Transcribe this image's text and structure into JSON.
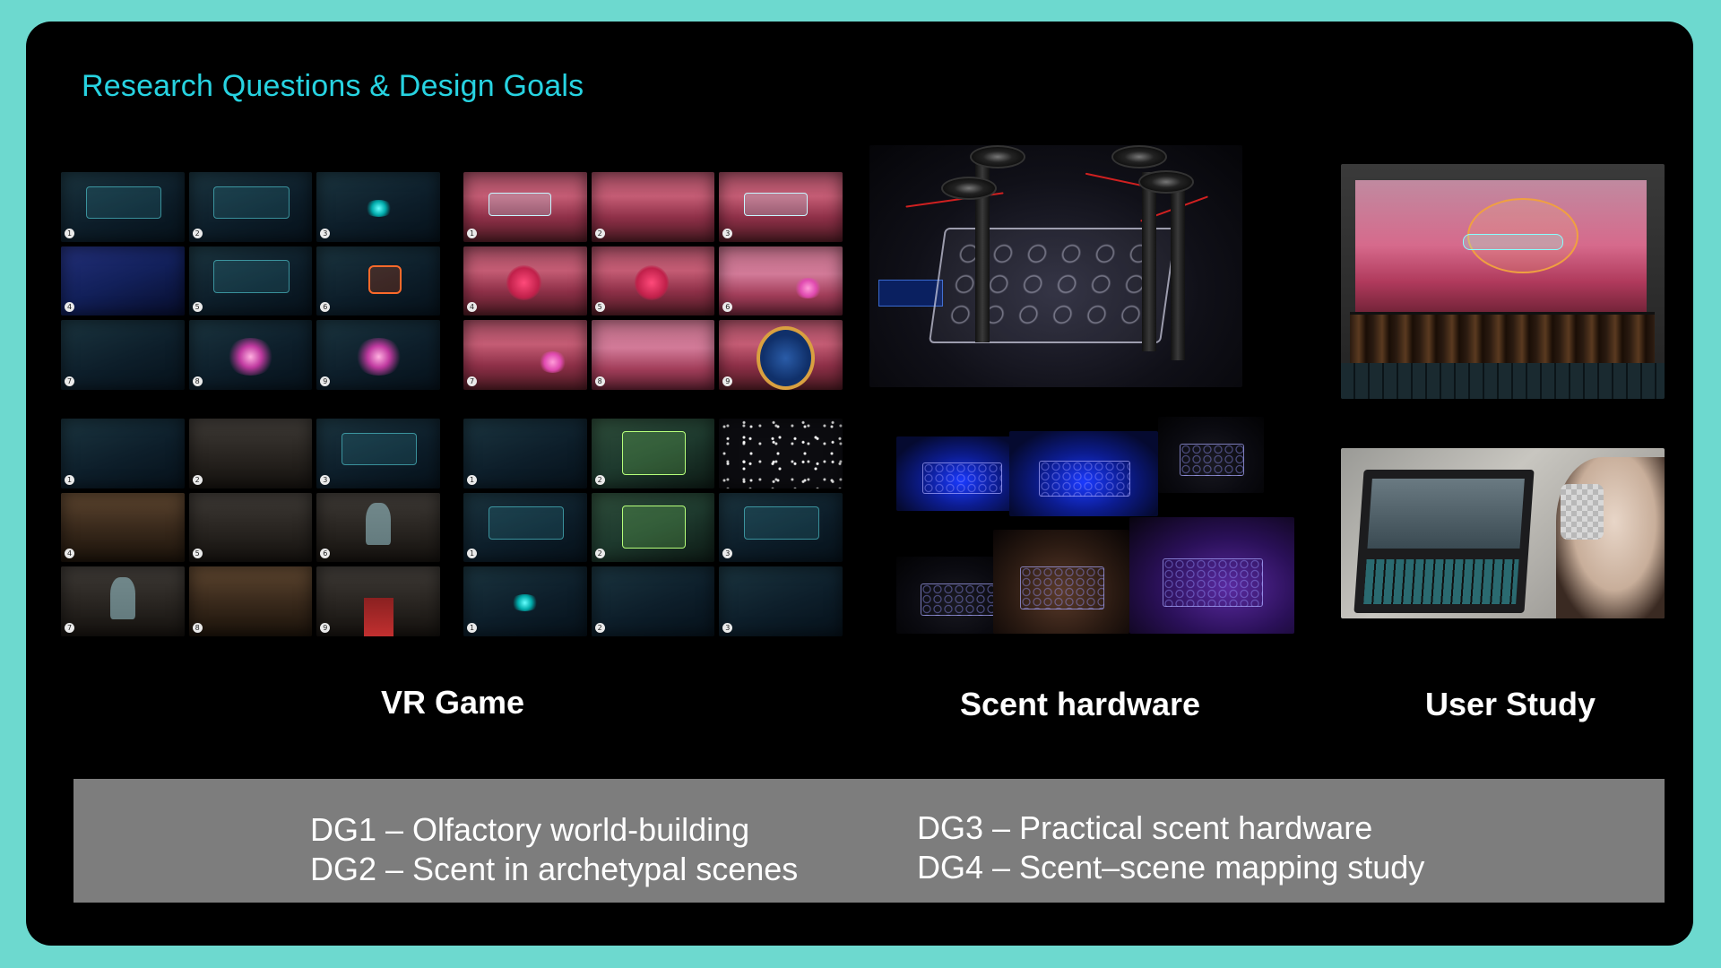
{
  "title": "Research Questions & Design Goals",
  "labels": {
    "vr_game": "VR Game",
    "scent_hardware": "Scent hardware",
    "user_study": "User Study"
  },
  "design_goals": [
    "DG1 – Olfactory world-building",
    "DG2 – Scent in archetypal scenes",
    "DG3 – Practical scent hardware",
    "DG4 – Scent–scene mapping study"
  ],
  "grids": [
    {
      "tiles": [
        {
          "n": "1",
          "cls": "sci glow"
        },
        {
          "n": "2",
          "cls": "sci glow"
        },
        {
          "n": "3",
          "cls": "sci cyan"
        },
        {
          "n": "4",
          "cls": "sci blue"
        },
        {
          "n": "5",
          "cls": "sci glow"
        },
        {
          "n": "6",
          "cls": "sci orange"
        },
        {
          "n": "7",
          "cls": "sci"
        },
        {
          "n": "8",
          "cls": "sci pink"
        },
        {
          "n": "9",
          "cls": "sci pink"
        }
      ]
    },
    {
      "tiles": [
        {
          "n": "1",
          "cls": "forest panel"
        },
        {
          "n": "2",
          "cls": "forest"
        },
        {
          "n": "3",
          "cls": "forest panel"
        },
        {
          "n": "4",
          "cls": "forest creature"
        },
        {
          "n": "5",
          "cls": "forest creature"
        },
        {
          "n": "6",
          "cls": "forest mist pinkorb"
        },
        {
          "n": "7",
          "cls": "forest pinkorb"
        },
        {
          "n": "8",
          "cls": "forest mist"
        },
        {
          "n": "9",
          "cls": "forest ring"
        }
      ]
    },
    {
      "tiles": [
        {
          "n": "1",
          "cls": "sci box"
        },
        {
          "n": "2",
          "cls": "church"
        },
        {
          "n": "3",
          "cls": "sci glow"
        },
        {
          "n": "4",
          "cls": "church warm"
        },
        {
          "n": "5",
          "cls": "church"
        },
        {
          "n": "6",
          "cls": "church ghost"
        },
        {
          "n": "7",
          "cls": "church ghost"
        },
        {
          "n": "8",
          "cls": "church warm"
        },
        {
          "n": "9",
          "cls": "church red"
        }
      ]
    },
    {
      "tiles": [
        {
          "n": "1",
          "cls": "sci"
        },
        {
          "n": "2",
          "cls": "sci green"
        },
        {
          "n": "",
          "cls": "stars"
        },
        {
          "n": "1",
          "cls": "sci glow"
        },
        {
          "n": "2",
          "cls": "sci green"
        },
        {
          "n": "3",
          "cls": "sci glow"
        },
        {
          "n": "1",
          "cls": "sci cyan"
        },
        {
          "n": "2",
          "cls": "sci"
        },
        {
          "n": "3",
          "cls": "sci"
        }
      ]
    }
  ]
}
